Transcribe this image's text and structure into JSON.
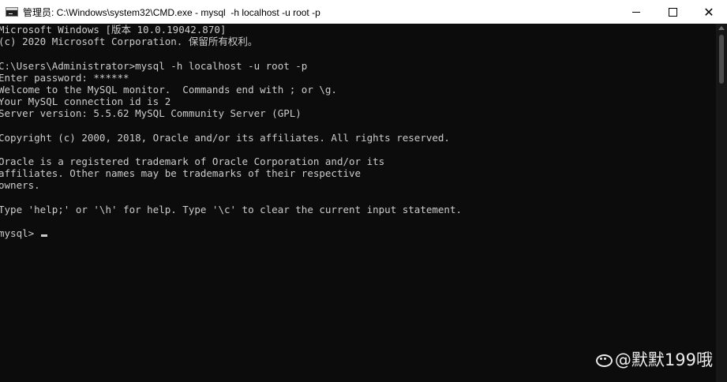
{
  "window": {
    "title": "管理员: C:\\Windows\\system32\\CMD.exe - mysql  -h localhost -u root -p",
    "icon": "cmd-icon"
  },
  "caption_buttons": {
    "minimize": "minimize-icon",
    "maximize": "maximize-icon",
    "close": "✕"
  },
  "console": {
    "lines": [
      "Microsoft Windows [版本 10.0.19042.870]",
      "(c) 2020 Microsoft Corporation. 保留所有权利。",
      "",
      "C:\\Users\\Administrator>mysql -h localhost -u root -p",
      "Enter password: ******",
      "Welcome to the MySQL monitor.  Commands end with ; or \\g.",
      "Your MySQL connection id is 2",
      "Server version: 5.5.62 MySQL Community Server (GPL)",
      "",
      "Copyright (c) 2000, 2018, Oracle and/or its affiliates. All rights reserved.",
      "",
      "Oracle is a registered trademark of Oracle Corporation and/or its",
      "affiliates. Other names may be trademarks of their respective",
      "owners.",
      "",
      "Type 'help;' or '\\h' for help. Type '\\c' to clear the current input statement.",
      ""
    ],
    "prompt": "mysql> "
  },
  "colors": {
    "console_bg": "#0c0c0c",
    "console_fg": "#cccccc",
    "titlebar_bg": "#ffffff"
  },
  "watermark": {
    "text": "@默默199哦"
  }
}
